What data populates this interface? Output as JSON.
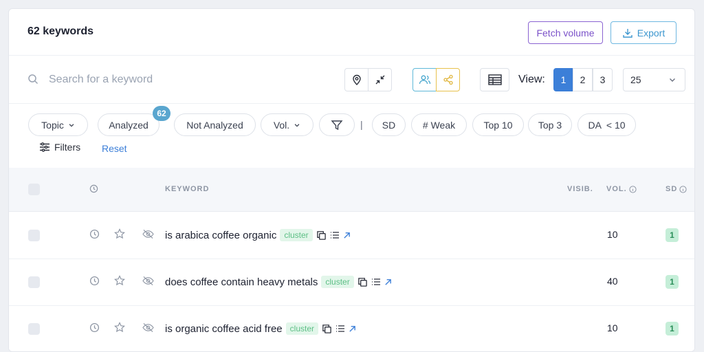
{
  "header": {
    "title": "62 keywords",
    "fetch_volume_label": "Fetch volume",
    "export_label": "Export"
  },
  "search": {
    "placeholder": "Search for a keyword"
  },
  "view": {
    "label": "View:",
    "pages": [
      "1",
      "2",
      "3"
    ],
    "active_page": "1",
    "per_page": "25"
  },
  "filters": {
    "topic": "Topic",
    "analyzed": "Analyzed",
    "analyzed_count": "62",
    "not_analyzed": "Not Analyzed",
    "vol": "Vol.",
    "separator": "|",
    "sd": "SD",
    "weak": "# Weak",
    "top10": "Top 10",
    "top3": "Top 3",
    "da": "DA  < 10",
    "filters_label": "Filters",
    "reset_label": "Reset"
  },
  "table": {
    "headers": {
      "keyword": "KEYWORD",
      "visib": "VISIB.",
      "vol": "VOL.",
      "sd": "SD"
    },
    "rows": [
      {
        "keyword": "is arabica coffee organic",
        "tag": "cluster",
        "vol": "10",
        "sd": "1"
      },
      {
        "keyword": "does coffee contain heavy metals",
        "tag": "cluster",
        "vol": "40",
        "sd": "1"
      },
      {
        "keyword": "is organic coffee acid free",
        "tag": "cluster",
        "vol": "10",
        "sd": "1"
      }
    ]
  },
  "colors": {
    "accent_blue": "#3c7fd8",
    "fetch_purple": "#7b52c9",
    "export_blue": "#3d97cf",
    "cluster_green": "#5cbf85",
    "sd_green_bg": "#c5eed8"
  }
}
